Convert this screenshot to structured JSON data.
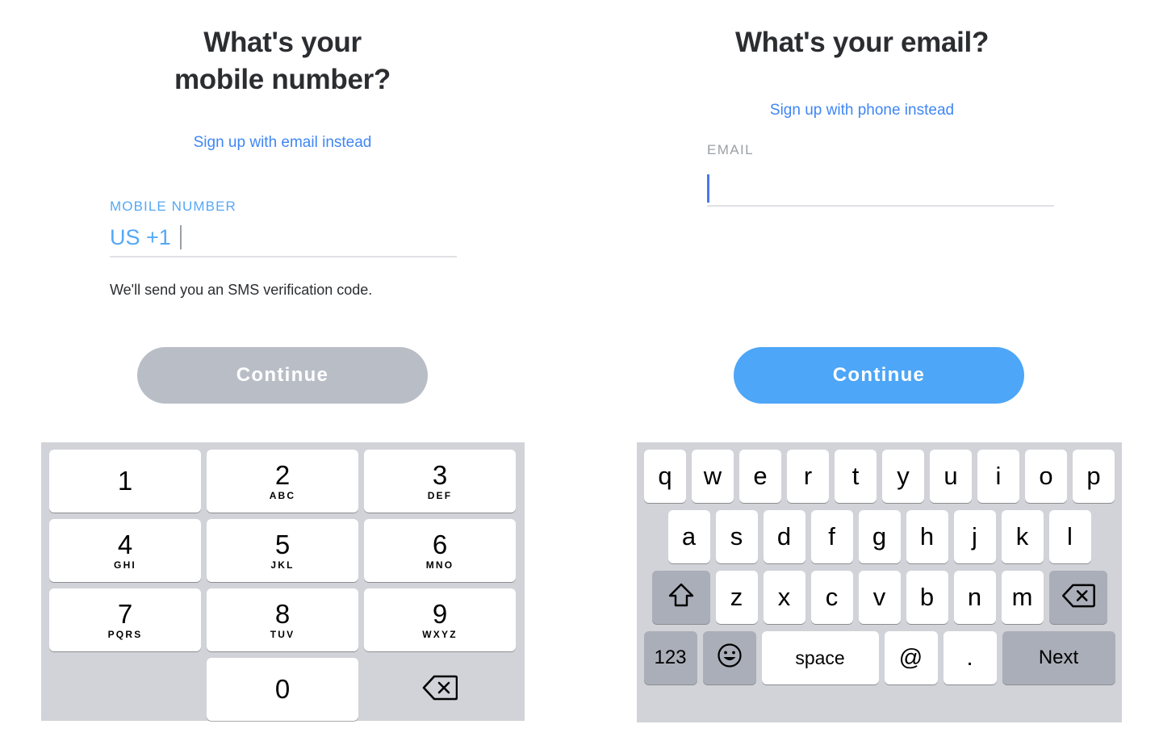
{
  "phone_screen": {
    "title_line1": "What's your",
    "title_line2": "mobile number?",
    "alt_link": "Sign up with email instead",
    "field_label": "MOBILE NUMBER",
    "country_code": "US +1",
    "input_value": "",
    "helper_text": "We'll send you an SMS verification code.",
    "continue_label": "Continue",
    "continue_enabled": false,
    "accent_blue": "#55a8f7",
    "link_blue": "#4086f4",
    "disabled_button_color": "#b9bec6"
  },
  "email_screen": {
    "title": "What's your email?",
    "alt_link": "Sign up with phone instead",
    "field_label": "EMAIL",
    "input_value": "",
    "continue_label": "Continue",
    "continue_enabled": true,
    "label_gray": "#9aa0a6",
    "link_blue": "#4086f4",
    "enabled_button_color": "#4da6f7",
    "caret_color": "#4a78f0"
  },
  "numeric_keypad": {
    "background": "#d1d3d8",
    "keys": [
      {
        "digit": "1",
        "letters": ""
      },
      {
        "digit": "2",
        "letters": "ABC"
      },
      {
        "digit": "3",
        "letters": "DEF"
      },
      {
        "digit": "4",
        "letters": "GHI"
      },
      {
        "digit": "5",
        "letters": "JKL"
      },
      {
        "digit": "6",
        "letters": "MNO"
      },
      {
        "digit": "7",
        "letters": "PQRS"
      },
      {
        "digit": "8",
        "letters": "TUV"
      },
      {
        "digit": "9",
        "letters": "WXYZ"
      },
      {
        "digit": "0",
        "letters": ""
      }
    ],
    "delete_icon": "backspace-icon"
  },
  "qwerty_keyboard": {
    "background": "#d1d3d8",
    "modifier_color": "#a9aeb8",
    "row1": [
      "q",
      "w",
      "e",
      "r",
      "t",
      "y",
      "u",
      "i",
      "o",
      "p"
    ],
    "row2": [
      "a",
      "s",
      "d",
      "f",
      "g",
      "h",
      "j",
      "k",
      "l"
    ],
    "row3": [
      "z",
      "x",
      "c",
      "v",
      "b",
      "n",
      "m"
    ],
    "shift_icon": "shift-arrow-icon",
    "backspace_icon": "backspace-icon",
    "numbers_label": "123",
    "emoji_icon": "smiley-face-icon",
    "space_label": "space",
    "at_label": "@",
    "dot_label": ".",
    "next_label": "Next"
  }
}
